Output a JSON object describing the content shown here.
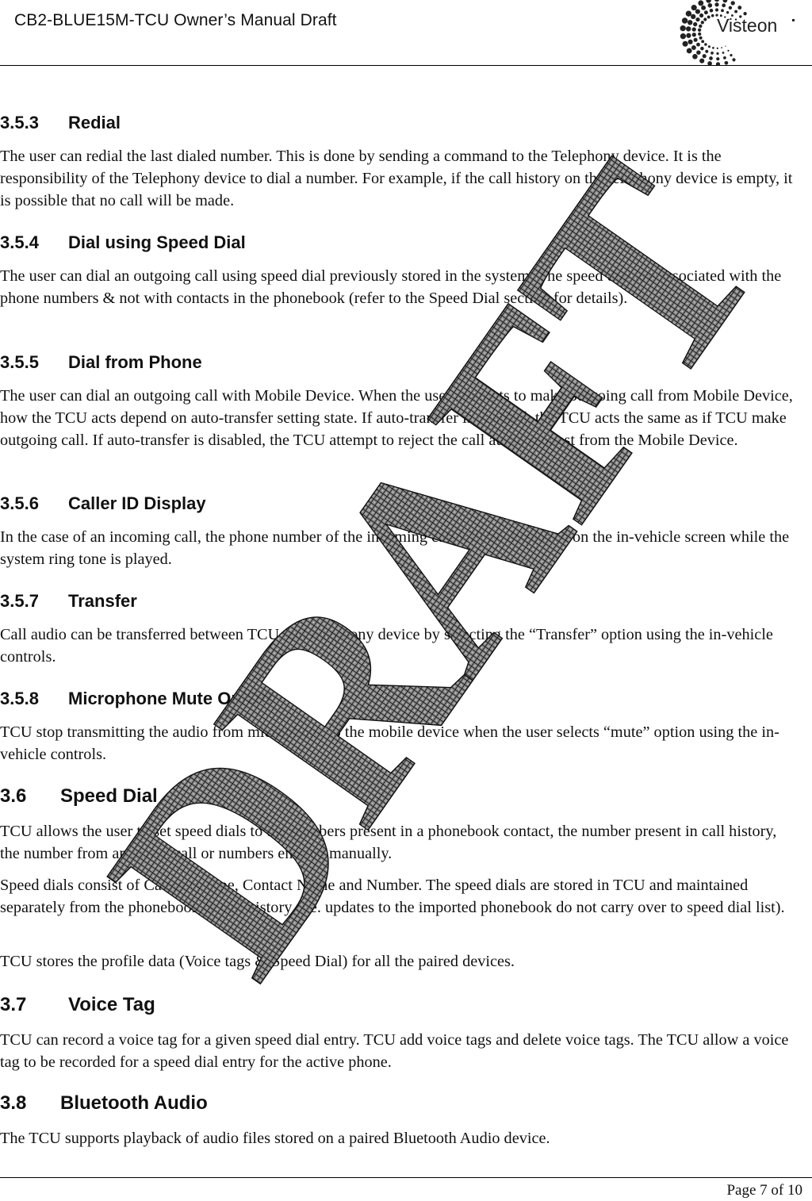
{
  "header": {
    "title": "CB2-BLUE15M-TCU Owner’s Manual Draft",
    "logo_text": "Visteon"
  },
  "footer": {
    "page_number": "Page 7 of 10"
  },
  "watermark": {
    "text": "DRAFT"
  },
  "sections": [
    {
      "number": "3.5.3",
      "title": "Redial",
      "paragraphs": [
        "The user can redial the last dialed number.  This is done by sending a command to the Telephony device.  It is the responsibility of the Telephony device to dial a number.  For example, if the call history on the telephony device is empty, it is possible that no call will be made."
      ]
    },
    {
      "number": "3.5.4",
      "title": "Dial using Speed Dial",
      "paragraphs": [
        "The user can dial an outgoing call using speed dial previously stored in the system. The speed dial are associated with the phone numbers & not with contacts in the phonebook (refer to the Speed Dial section for details)."
      ]
    },
    {
      "number": "3.5.5",
      "title": "Dial from Phone",
      "paragraphs": [
        "The user can dial an outgoing call with Mobile Device. When the user attempts to make outgoing call from Mobile Device, how the TCU acts depend on auto-transfer setting state.  If auto-transfer is enabled, the TCU acts the same as if TCU make outgoing call. If auto-transfer is disabled, the TCU attempt to reject the call audio request from the Mobile Device."
      ]
    },
    {
      "number": "3.5.6",
      "title": "Caller ID Display",
      "paragraphs": [
        "In the case of an incoming call, the phone number of the incoming call will be displayed on the in-vehicle screen while the system ring tone is played."
      ]
    },
    {
      "number": "3.5.7",
      "title": "Transfer",
      "paragraphs": [
        "Call audio can be transferred between TCU and telephony device by selecting the “Transfer” option using the in-vehicle controls."
      ]
    },
    {
      "number": "3.5.8",
      "title": "Microphone Mute On/Off",
      "paragraphs": [
        "TCU stop transmitting the audio from microphone to the mobile device when the user selects “mute” option using the in-vehicle controls."
      ]
    },
    {
      "number": "3.6",
      "title": "Speed Dial",
      "paragraphs": [
        "TCU allows the user to set speed dials to the numbers present in a phonebook contact, the number present in call history, the number from an active call or numbers entered manually.",
        "Speed dials consist of Category type, Contact Name and Number.  The speed dials are stored in TCU and maintained separately from the phonebook & call history (i.e. updates to the imported phonebook do not carry over to speed dial list).",
        "TCU stores the profile data (Voice tags & Speed Dial) for all the paired devices."
      ]
    },
    {
      "number": "3.7",
      "title": "Voice Tag",
      "paragraphs": [
        "TCU can record a voice tag for a given speed dial entry. TCU add voice tags and delete voice tags. The TCU allow a voice tag to be recorded for a speed dial entry for the active phone."
      ]
    },
    {
      "number": "3.8",
      "title": "Bluetooth Audio",
      "paragraphs": [
        "The TCU supports playback of audio files stored on a paired Bluetooth Audio device."
      ]
    }
  ]
}
